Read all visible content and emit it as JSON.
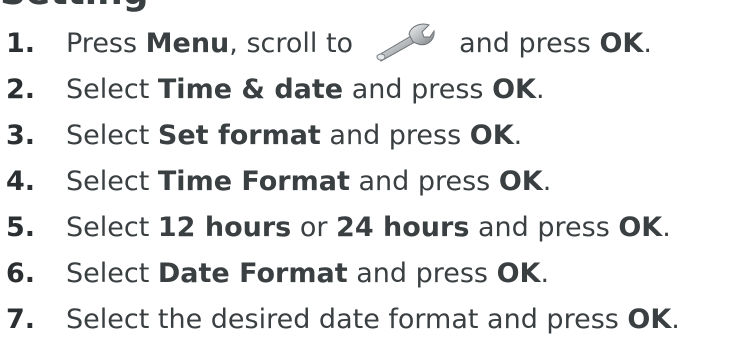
{
  "heading": {
    "text": "Setting"
  },
  "steps": [
    {
      "num": "1.",
      "t1": "Press ",
      "b1": "Menu",
      "t2": ", scroll to",
      "icon": "wrench-icon",
      "t3": "and press ",
      "b2": "OK",
      "t4": "."
    },
    {
      "num": "2.",
      "t1": "Select ",
      "b1": "Time & date",
      "t2": " and press ",
      "b2": "OK",
      "t3": "."
    },
    {
      "num": "3.",
      "t1": "Select ",
      "b1": "Set format",
      "t2": " and press ",
      "b2": "OK",
      "t3": "."
    },
    {
      "num": "4.",
      "t1": "Select ",
      "b1": "Time Format",
      "t2": " and press ",
      "b2": "OK",
      "t3": "."
    },
    {
      "num": "5.",
      "t1": "Select ",
      "b1": "12 hours",
      "t2": " or ",
      "b2": "24 hours",
      "t3": " and press ",
      "b3": "OK",
      "t4": "."
    },
    {
      "num": "6.",
      "t1": "Select ",
      "b1": "Date Format",
      "t2": " and press ",
      "b2": "OK",
      "t3": "."
    },
    {
      "num": "7.",
      "t1": "Select the desired date format and press ",
      "b1": "OK",
      "t2": "."
    }
  ]
}
